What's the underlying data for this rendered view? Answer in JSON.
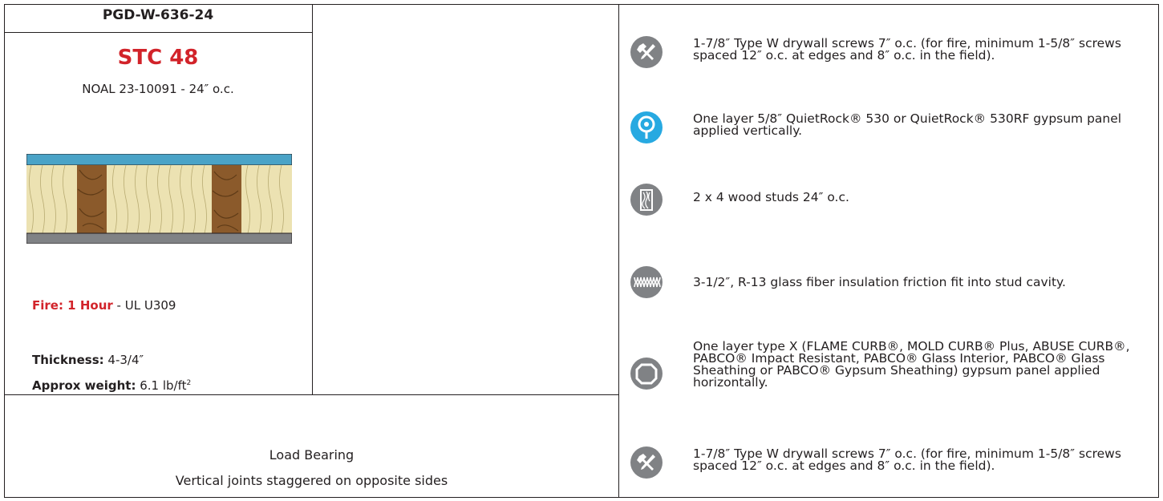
{
  "left": {
    "assembly_code": "PGD-W-636-24",
    "stc": "STC 48",
    "test_ref": "NOAL 23-10091 - 24″ o.c.",
    "fire_label": "Fire: 1 Hour",
    "fire_value": " - UL U309",
    "thickness_label": "Thickness:",
    "thickness_value": " 4-3/4″",
    "weight_label": "Approx weight:",
    "weight_value": " 6.1 lb/ft",
    "weight_sup": "2"
  },
  "notes": {
    "line1": "Load Bearing",
    "line2": "Vertical joints staggered on opposite sides"
  },
  "components": [
    {
      "icon": "screw-tool-icon",
      "text": "1-7/8″ Type W drywall screws 7″ o.c. (for fire, minimum 1-5/8″ screws spaced 12″ o.c. at edges and 8″ o.c. in the field)."
    },
    {
      "icon": "quietrock-panel-icon",
      "text": "One layer 5/8″ QuietRock® 530 or QuietRock® 530RF gypsum panel applied vertically."
    },
    {
      "icon": "wood-stud-icon",
      "text": "2 x 4 wood studs 24″ o.c."
    },
    {
      "icon": "insulation-icon",
      "text": "3-1/2″, R-13 glass fiber insulation friction fit into stud cavity."
    },
    {
      "icon": "gypsum-panel-icon",
      "text": "One layer type X (FLAME CURB®, MOLD CURB® Plus, ABUSE CURB®, PABCO® Impact Resistant, PABCO® Glass Interior, PABCO® Glass Sheathing or PABCO® Gypsum Sheathing) gypsum panel applied horizontally."
    },
    {
      "icon": "screw-tool-icon",
      "text": "1-7/8″ Type W drywall screws 7″ o.c. (for fire, minimum 1-5/8″ screws spaced 12″ o.c. at edges and 8″ o.c. in the field)."
    }
  ],
  "colors": {
    "stc_red": "#d2232a",
    "icon_gray": "#808285",
    "icon_blue": "#27a9e1",
    "quietrock_layer": "#4aa3c7",
    "insulation": "#ece2b2",
    "stud": "#8b5a2b",
    "gypsum_layer": "#808285"
  }
}
